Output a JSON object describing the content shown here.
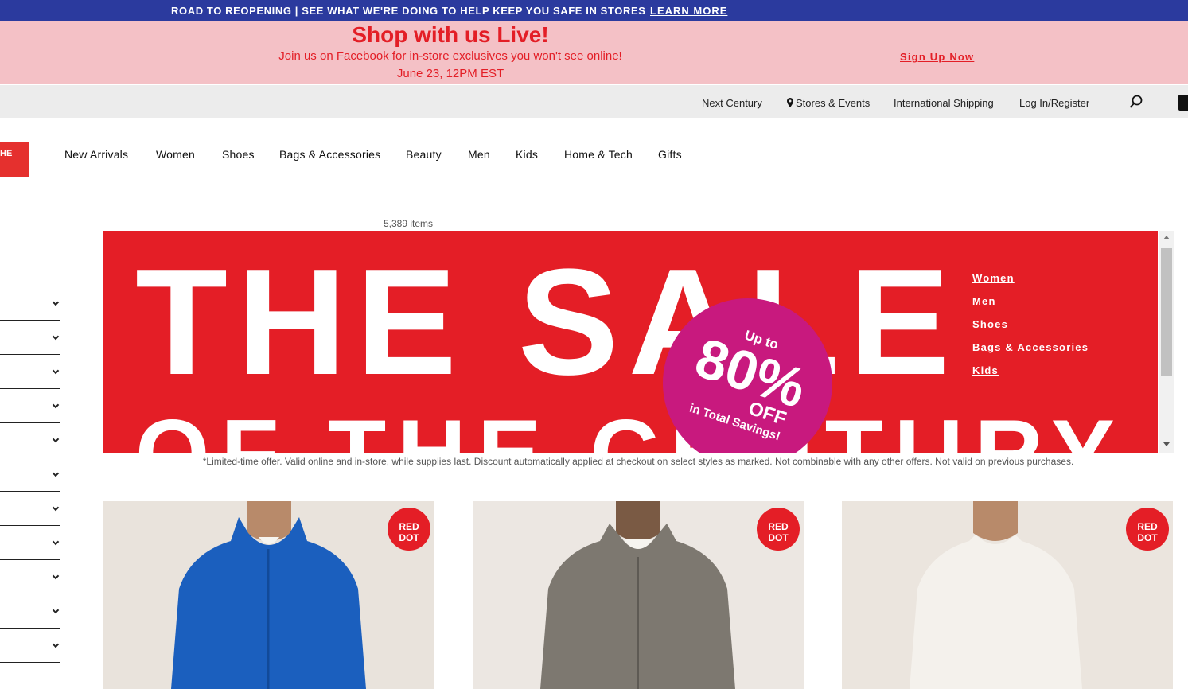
{
  "announcement": {
    "message": "ROAD TO REOPENING | SEE WHAT WE'RE DOING TO HELP KEEP YOU SAFE IN STORES",
    "link": "LEARN MORE"
  },
  "promo": {
    "headline": "Shop with us Live!",
    "subline": "Join us on Facebook for in-store exclusives you won't see online!",
    "date": "June 23, 12PM EST",
    "cta": "Sign Up Now"
  },
  "utility_nav": {
    "items": [
      "Next Century",
      "Stores & Events",
      "International Shipping",
      "Log In/Register"
    ]
  },
  "logo_fragment": "HE",
  "main_nav": [
    "New Arrivals",
    "Women",
    "Shoes",
    "Bags & Accessories",
    "Beauty",
    "Men",
    "Kids",
    "Home & Tech",
    "Gifts"
  ],
  "item_count": "5,389 items",
  "banner": {
    "line1": "THE SALE",
    "line2": "OF THE CENTURY",
    "badge_upto": "Up to",
    "badge_pct": "80%",
    "badge_off": "OFF",
    "badge_savings": "in Total Savings!",
    "links": [
      "Women",
      "Men",
      "Shoes",
      "Bags & Accessories",
      "Kids"
    ]
  },
  "disclaimer": "*Limited-time offer. Valid online and in-store, while supplies last. Discount automatically applied at checkout on select styles as marked. Not combinable with any other offers. Not valid on previous purchases.",
  "products": [
    {
      "badge": "RED DOT",
      "color": "#1b5fbe"
    },
    {
      "badge": "RED DOT",
      "color": "#7d7870"
    },
    {
      "badge": "RED DOT",
      "color": "#f4f1ec"
    }
  ],
  "colors": {
    "topbar": "#2b3a9e",
    "promo_bg": "#f4c1c6",
    "brand_red": "#e41e26",
    "badge_magenta": "#c8197e"
  }
}
